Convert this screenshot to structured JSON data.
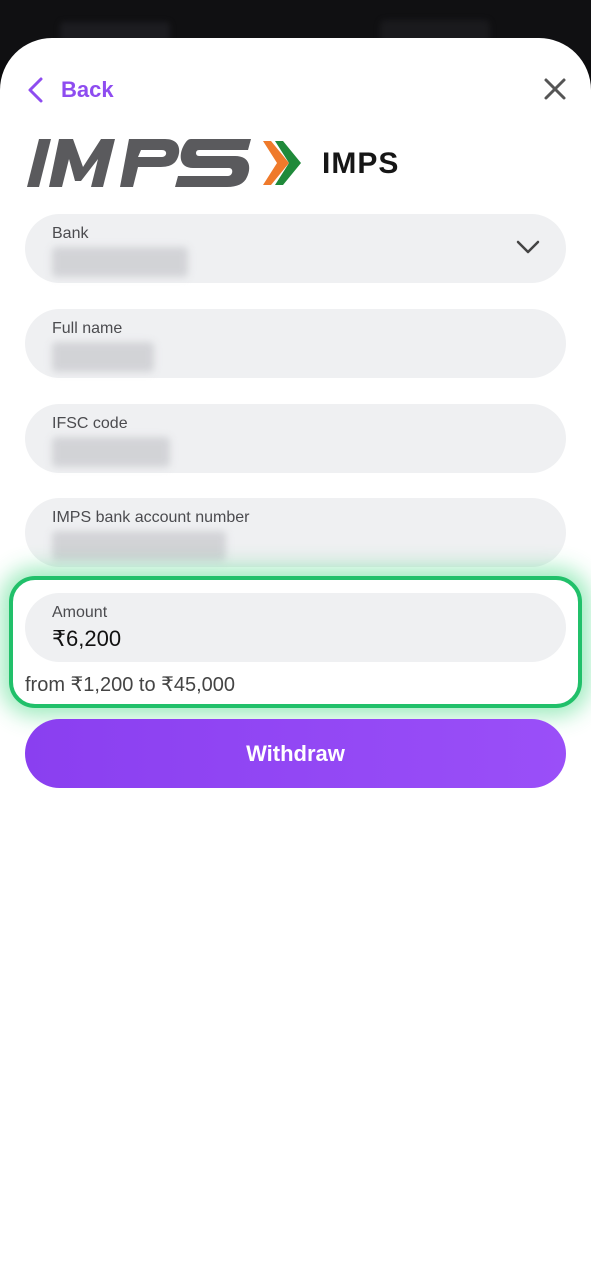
{
  "header": {
    "back_label": "Back",
    "close_icon": "close-icon",
    "back_icon": "chevron-left-icon"
  },
  "method": {
    "logo_icon": "imps-logo",
    "name": "IMPS"
  },
  "form": {
    "bank": {
      "label": "Bank",
      "value": "",
      "icon": "chevron-down-icon"
    },
    "full_name": {
      "label": "Full name",
      "value": ""
    },
    "ifsc": {
      "label": "IFSC code",
      "value": ""
    },
    "account_number": {
      "label": "IMPS bank account number",
      "value": ""
    },
    "amount": {
      "label": "Amount",
      "value": "₹6,200",
      "range_text": "from ₹1,200 to ₹45,000"
    }
  },
  "actions": {
    "withdraw_label": "Withdraw"
  },
  "colors": {
    "accent": "#8e4cf0",
    "highlight": "#21c06a",
    "field_bg": "#eff0f2"
  }
}
